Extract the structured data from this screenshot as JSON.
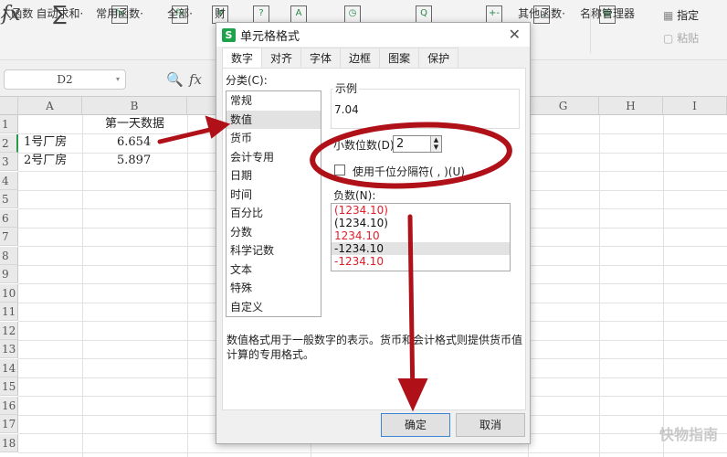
{
  "toolbar": {
    "items": [
      {
        "icon": "fx",
        "label": "插入函数"
      },
      {
        "icon": "∑",
        "label": "自动求和·"
      },
      {
        "icon": "fx",
        "label": "常用函数·"
      },
      {
        "icon": "fx",
        "label": "全部·"
      },
      {
        "icon": "¥",
        "label": "财"
      },
      {
        "icon": "?",
        "label": ""
      },
      {
        "icon": "A",
        "label": ""
      },
      {
        "icon": "◷",
        "label": ""
      },
      {
        "icon": "Q",
        "label": ""
      },
      {
        "icon": "+-",
        "label": ""
      },
      {
        "icon": "…",
        "label": "其他函数·"
      },
      {
        "icon": "▤",
        "label": "名称管理器"
      }
    ],
    "specify": "指定",
    "paste": "粘贴"
  },
  "formula_bar": {
    "name_box": "D2",
    "fx": "fx"
  },
  "sheet": {
    "columns": [
      "A",
      "B",
      "G",
      "H",
      "I"
    ],
    "rows": [
      "1",
      "2",
      "3",
      "4",
      "5",
      "6",
      "7",
      "8",
      "9",
      "10",
      "11",
      "12",
      "13",
      "14",
      "15",
      "16",
      "17",
      "18"
    ],
    "cells": {
      "B1": "第一天数据",
      "A2": "1号厂房",
      "B2": "6.654",
      "A3": "2号厂房",
      "B3": "5.897"
    }
  },
  "dialog": {
    "title": "单元格格式",
    "logo": "S",
    "tabs": [
      "数字",
      "对齐",
      "字体",
      "边框",
      "图案",
      "保护"
    ],
    "category_label": "分类(C):",
    "categories": [
      "常规",
      "数值",
      "货币",
      "会计专用",
      "日期",
      "时间",
      "百分比",
      "分数",
      "科学记数",
      "文本",
      "特殊",
      "自定义"
    ],
    "selected_category": "数值",
    "sample_label": "示例",
    "sample_value": "7.04",
    "decimal_label": "小数位数(D):",
    "decimal_value": "2",
    "thousands_label": "使用千位分隔符( , )(U)",
    "thousands_checked": false,
    "negative_label": "负数(N):",
    "negatives": [
      {
        "text": "(1234.10)",
        "color": "#e0202a"
      },
      {
        "text": "(1234.10)",
        "color": "#111111"
      },
      {
        "text": "1234.10",
        "color": "#e0202a"
      },
      {
        "text": "-1234.10",
        "color": "#111111"
      },
      {
        "text": "-1234.10",
        "color": "#e0202a"
      }
    ],
    "description": "数值格式用于一般数字的表示。货币和会计格式则提供货币值计算的专用格式。",
    "ok": "确定",
    "cancel": "取消"
  },
  "annotation_color": "#b01018",
  "watermark": "快物指南"
}
